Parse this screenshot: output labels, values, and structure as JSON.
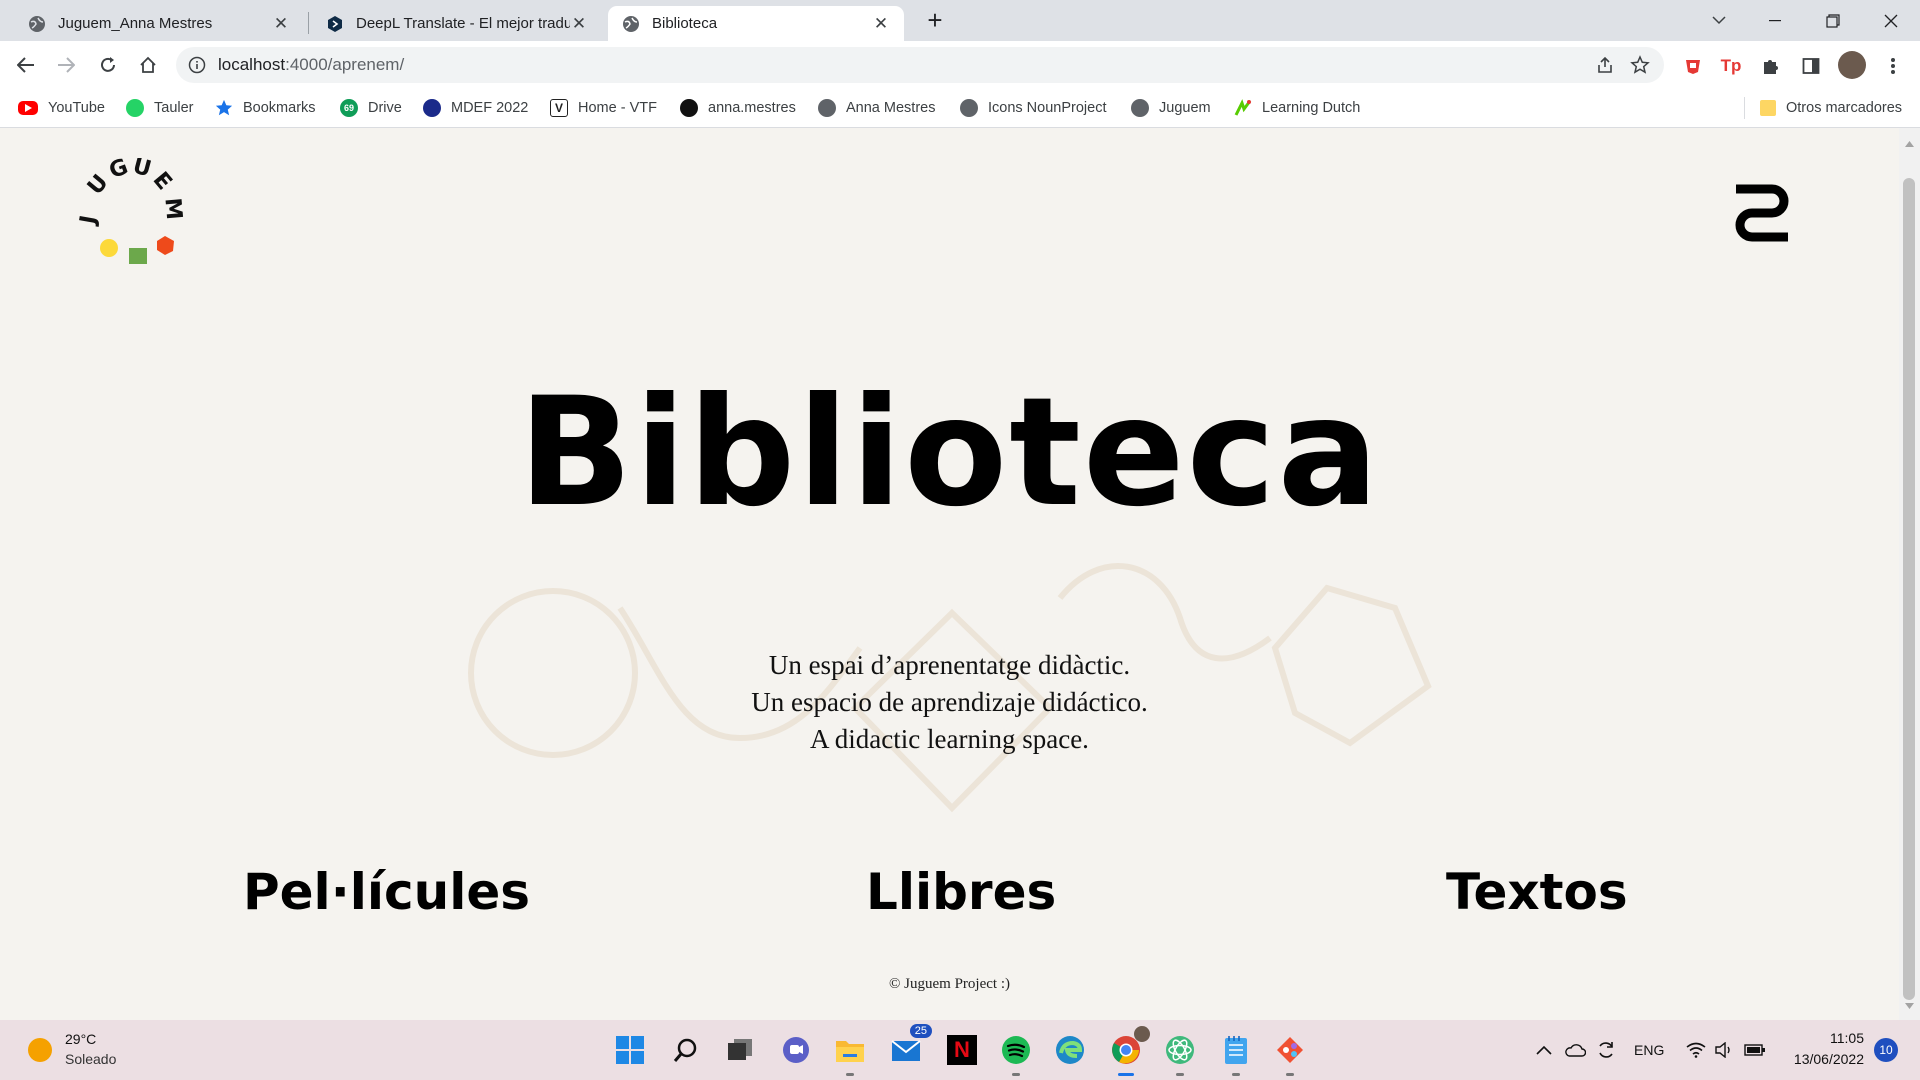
{
  "browser": {
    "tabs": [
      {
        "title": "Juguem_Anna Mestres",
        "active": false
      },
      {
        "title": "DeepL Translate - El mejor traduc",
        "active": false
      },
      {
        "title": "Biblioteca",
        "active": true
      }
    ],
    "url_host": "localhost",
    "url_path": ":4000/aprenem/",
    "bookmarks": [
      {
        "label": "YouTube",
        "icon": "youtube-icon",
        "color": "#ff0000"
      },
      {
        "label": "Tauler",
        "icon": "whatsapp-icon",
        "color": "#25d366"
      },
      {
        "label": "Bookmarks",
        "icon": "star-icon",
        "color": "#1a73e8"
      },
      {
        "label": "Drive",
        "icon": "drive-icon",
        "color": "#0f9d58"
      },
      {
        "label": "MDEF 2022",
        "icon": "mdef-icon",
        "color": "#1b2a8a"
      },
      {
        "label": "Home - VTF",
        "icon": "vtf-icon",
        "color": "#222222"
      },
      {
        "label": "anna.mestres",
        "icon": "github-icon",
        "color": "#111111"
      },
      {
        "label": "Anna Mestres",
        "icon": "globe-icon",
        "color": "#5f6368"
      },
      {
        "label": "Icons NounProject",
        "icon": "globe-icon",
        "color": "#5f6368"
      },
      {
        "label": "Juguem",
        "icon": "globe-icon",
        "color": "#5f6368"
      },
      {
        "label": "Learning Dutch",
        "icon": "duolingo-icon",
        "color": "#58cc02"
      }
    ],
    "other_bookmarks": "Otros marcadores"
  },
  "page": {
    "logo_letters": "JUGUEM",
    "title": "Biblioteca",
    "subtitle_lines": [
      "Un espai d’aprenentatge didàctic.",
      "Un espacio de aprendizaje didáctico.",
      "A didactic learning space."
    ],
    "categories": [
      "Pel·lícules",
      "Llibres",
      "Textos"
    ],
    "footer": "© Juguem Project :)"
  },
  "taskbar": {
    "weather_temp": "29°C",
    "weather_desc": "Soleado",
    "mail_badge": "25",
    "language": "ENG",
    "time": "11:05",
    "date": "13/06/2022",
    "notifications": "10"
  }
}
